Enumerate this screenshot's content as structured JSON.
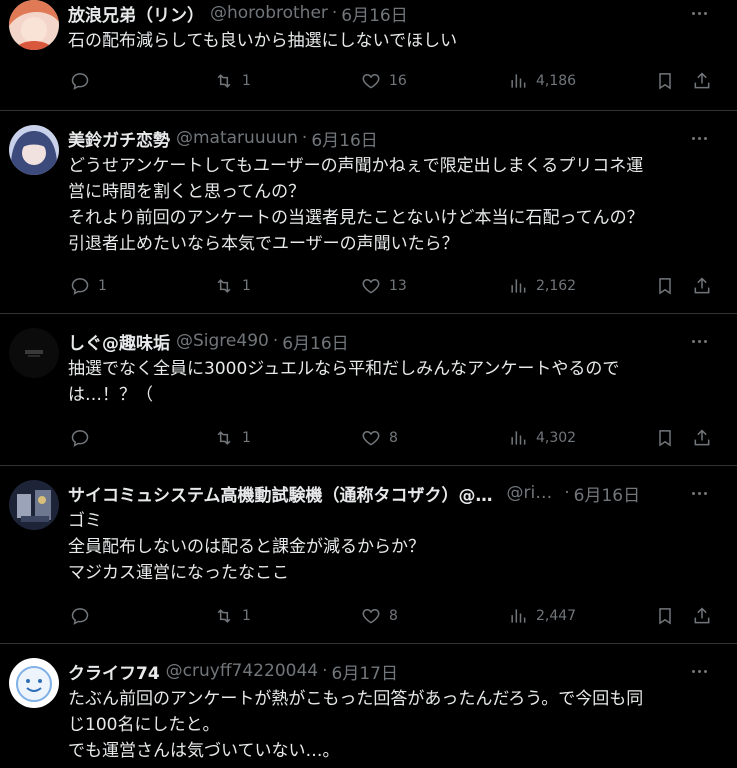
{
  "tweets": [
    {
      "name": "放浪兄弟（リン）",
      "handle": "@horobrother",
      "sep": "·",
      "date": "6月16日",
      "lines": [
        "石の配布減らしても良いから抽選にしないでほしい"
      ],
      "replies": "",
      "retweets": "1",
      "likes": "16",
      "views": "4,186",
      "avatar_color": "#e58a6a"
    },
    {
      "name": "美鈴ガチ恋勢",
      "handle": "@mataruuuun",
      "sep": "·",
      "date": "6月16日",
      "lines": [
        "どうせアンケートしてもユーザーの声聞かねぇで限定出しまくるプリコネ運",
        "営に時間を割くと思ってんの？",
        "それより前回のアンケートの当選者見たことないけど本当に石配ってんの？",
        "引退者止めたいなら本気でユーザーの声聞いたら？"
      ],
      "replies": "1",
      "retweets": "1",
      "likes": "13",
      "views": "2,162",
      "avatar_color": "#6a7fb5"
    },
    {
      "name": "しぐ@趣味垢",
      "handle": "@Sigre490",
      "sep": "·",
      "date": "6月16日",
      "lines": [
        "抽選でなく全員に3000ジュエルなら平和だしみんなアンケートやるので",
        "は…！？（"
      ],
      "replies": "",
      "retweets": "1",
      "likes": "8",
      "views": "4,302",
      "avatar_color": "#111111"
    },
    {
      "name": "サイコミュシステム高機動試験機（通称タコザク）@…",
      "handle": "@ri…",
      "sep": "·",
      "date": "6月16日",
      "lines": [
        "ゴミ",
        "全員配布しないのは配ると課金が減るからか？",
        "マジカス運営になったなここ"
      ],
      "replies": "",
      "retweets": "1",
      "likes": "8",
      "views": "2,447",
      "avatar_color": "#4a5a7a"
    },
    {
      "name": "クライフ74",
      "handle": "@cruyff74220044",
      "sep": "·",
      "date": "6月17日",
      "lines": [
        "たぶん前回のアンケートが熱がこもった回答があったんだろう。で今回も同",
        "じ100名にしたと。",
        "でも運営さんは気づいていない…。"
      ],
      "avatar_color": "#dfe9f7"
    }
  ]
}
